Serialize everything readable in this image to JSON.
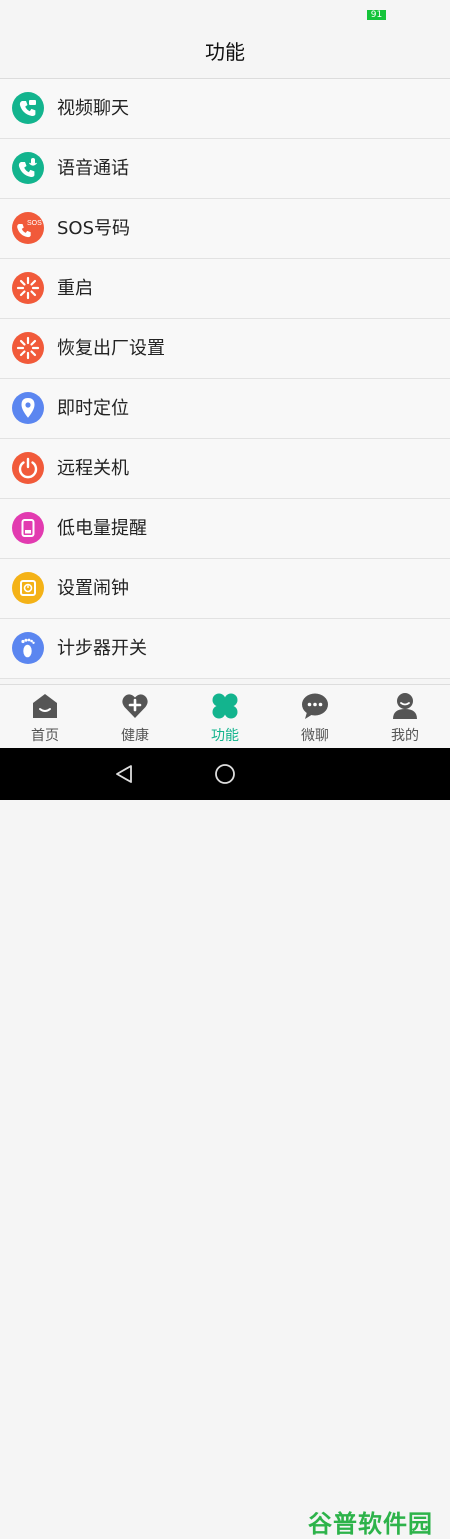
{
  "status": {
    "battery": "91"
  },
  "header": {
    "title": "功能"
  },
  "list": {
    "items": [
      {
        "label": "视频聊天",
        "icon": "video-call-icon",
        "color": "#13b48e"
      },
      {
        "label": "语音通话",
        "icon": "voice-call-icon",
        "color": "#13b48e"
      },
      {
        "label": "SOS号码",
        "icon": "sos-icon",
        "color": "#f15a3a"
      },
      {
        "label": "重启",
        "icon": "restart-icon",
        "color": "#f15a3a"
      },
      {
        "label": "恢复出厂设置",
        "icon": "factory-reset-icon",
        "color": "#f15a3a"
      },
      {
        "label": "即时定位",
        "icon": "location-icon",
        "color": "#5b86f0"
      },
      {
        "label": "远程关机",
        "icon": "power-icon",
        "color": "#f15a3a"
      },
      {
        "label": "低电量提醒",
        "icon": "low-battery-icon",
        "color": "#e23bb0"
      },
      {
        "label": "设置闹钟",
        "icon": "alarm-icon",
        "color": "#f4b217"
      },
      {
        "label": "计步器开关",
        "icon": "pedometer-icon",
        "color": "#5b86f0"
      }
    ]
  },
  "tabs": [
    {
      "label": "首页",
      "icon": "home-icon",
      "active": false
    },
    {
      "label": "健康",
      "icon": "health-icon",
      "active": false
    },
    {
      "label": "功能",
      "icon": "functions-icon",
      "active": true
    },
    {
      "label": "微聊",
      "icon": "chat-icon",
      "active": false
    },
    {
      "label": "我的",
      "icon": "profile-icon",
      "active": false
    }
  ],
  "colors": {
    "accent": "#13b48e",
    "orange": "#f15a3a",
    "blue": "#5b86f0",
    "pink": "#e23bb0",
    "yellow": "#f4b217",
    "tab_icon": "#555555"
  },
  "watermark": "谷普软件园"
}
